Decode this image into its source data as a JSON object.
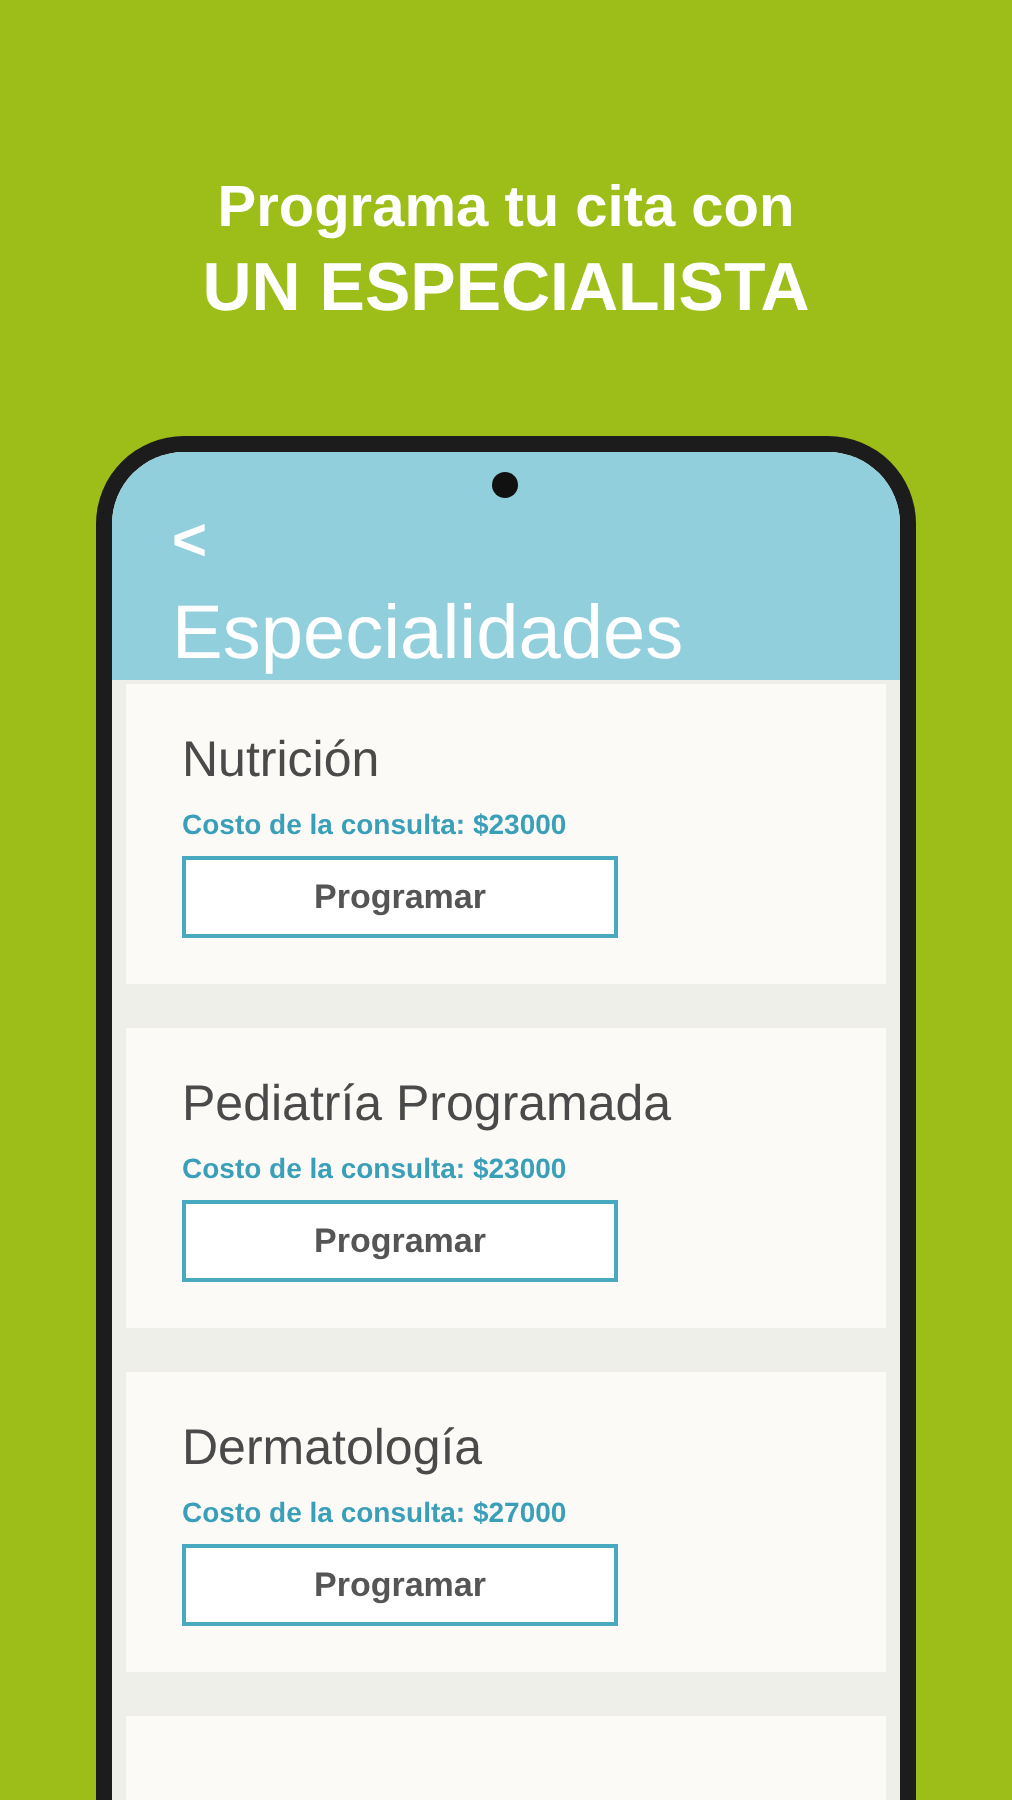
{
  "headline": {
    "line_1": "Programa tu cita con",
    "line_2": "UN ESPECIALISTA"
  },
  "screen": {
    "back": "<",
    "title": "Especialidades"
  },
  "specialties": [
    {
      "name": "Nutrición",
      "cost": "Costo de la consulta: $23000",
      "button": "Programar"
    },
    {
      "name": "Pediatría Programada",
      "cost": "Costo de la consulta: $23000",
      "button": "Programar"
    },
    {
      "name": "Dermatología",
      "cost": "Costo de la consulta: $27000",
      "button": "Programar"
    }
  ]
}
